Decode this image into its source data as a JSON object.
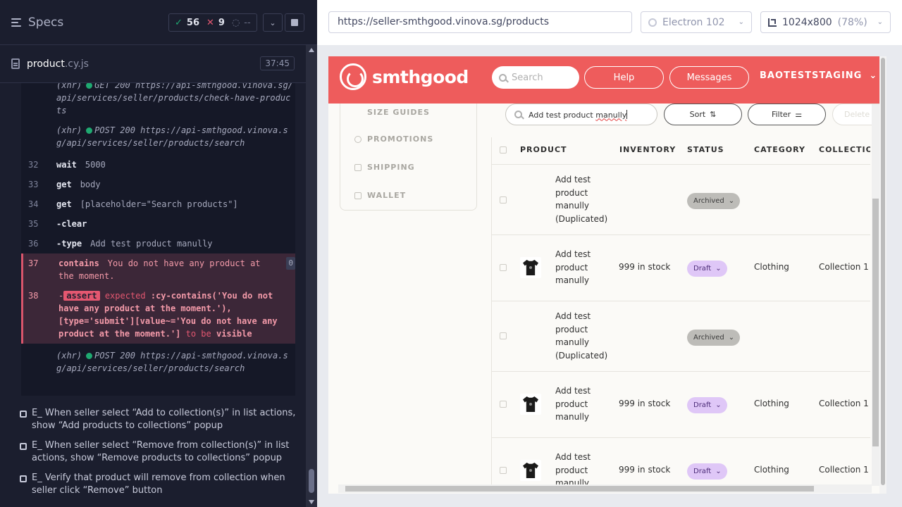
{
  "reporter": {
    "specs_label": "Specs",
    "stats": {
      "passed": "56",
      "failed": "9",
      "pending": "--"
    },
    "spec_file": {
      "name": "product",
      "ext": ".cy.js",
      "duration": "37:45"
    },
    "log": {
      "xhr1": {
        "prefix": "(xhr)",
        "method": "GET 200",
        "url": "https://api-smthgood.vinova.sg/api/services/seller/products/check-have-products"
      },
      "xhr2": {
        "prefix": "(xhr)",
        "method": "POST 200",
        "url": "https://api-smthgood.vinova.sg/api/services/seller/products/search"
      },
      "commands": [
        {
          "num": "32",
          "name": "wait",
          "arg": "5000"
        },
        {
          "num": "33",
          "name": "get",
          "arg": "body"
        },
        {
          "num": "34",
          "name": "get",
          "arg": "[placeholder=\"Search products\"]"
        },
        {
          "num": "35",
          "name": "-clear",
          "arg": ""
        },
        {
          "num": "36",
          "name": "-type",
          "arg": "Add test product manully"
        }
      ],
      "failed37": {
        "num": "37",
        "name": "contains",
        "text": "You do not have any product at the moment.",
        "count": "0"
      },
      "failed38": {
        "num": "38",
        "dash": "-",
        "badge": "assert",
        "expected": "expected",
        "selector": ":cy-contains('You do not have any product at the moment.'), [type='submit'][value~='You do not have any product at the moment.']",
        "to_be": "to be",
        "visible": "visible"
      },
      "xhr3": {
        "prefix": "(xhr)",
        "method": "POST 200",
        "url": "https://api-smthgood.vinova.sg/api/services/seller/products/search"
      }
    },
    "tests": [
      "E_ When seller select “Add to collection(s)” in list actions, show “Add products to collections” popup",
      "E_ When seller select “Remove from collection(s)” in list actions, show “Remove products to collections” popup",
      "E_ Verify that product will remove from collection when seller click “Remove” button"
    ]
  },
  "aut_bar": {
    "url": "https://seller-smthgood.vinova.sg/products",
    "browser": "Electron 102",
    "viewport": "1024x800",
    "scale": "(78%)"
  },
  "site": {
    "brand": "smthgood",
    "search_placeholder": "Search",
    "help": "Help",
    "messages": "Messages",
    "store": "BAOTESTSTAGING",
    "colors": {
      "header": "#ee5c5c",
      "draft": "#dfc7f7",
      "archived": "#bdbcb8"
    },
    "nav": [
      "SIZE GUIDES",
      "PROMOTIONS",
      "SHIPPING",
      "WALLET"
    ],
    "toolbar": {
      "search_value": "Add test product",
      "search_value_err": "manully",
      "sort": "Sort",
      "filter": "Filter",
      "delete": "Delete p"
    },
    "columns": [
      "PRODUCT",
      "INVENTORY",
      "STATUS",
      "CATEGORY",
      "COLLECTION"
    ],
    "rows": [
      {
        "name": "Add test product manully (Duplicated)",
        "inventory": "",
        "status": "Archived",
        "category": "",
        "collection": ""
      },
      {
        "name": "Add test product manully",
        "inventory": "999 in stock",
        "status": "Draft",
        "category": "Clothing",
        "collection": "Collection 1"
      },
      {
        "name": "Add test product manully (Duplicated)",
        "inventory": "",
        "status": "Archived",
        "category": "",
        "collection": ""
      },
      {
        "name": "Add test product manully",
        "inventory": "999 in stock",
        "status": "Draft",
        "category": "Clothing",
        "collection": "Collection 1"
      },
      {
        "name": "Add test product manully",
        "inventory": "999 in stock",
        "status": "Draft",
        "category": "Clothing",
        "collection": "Collection 1"
      }
    ]
  }
}
